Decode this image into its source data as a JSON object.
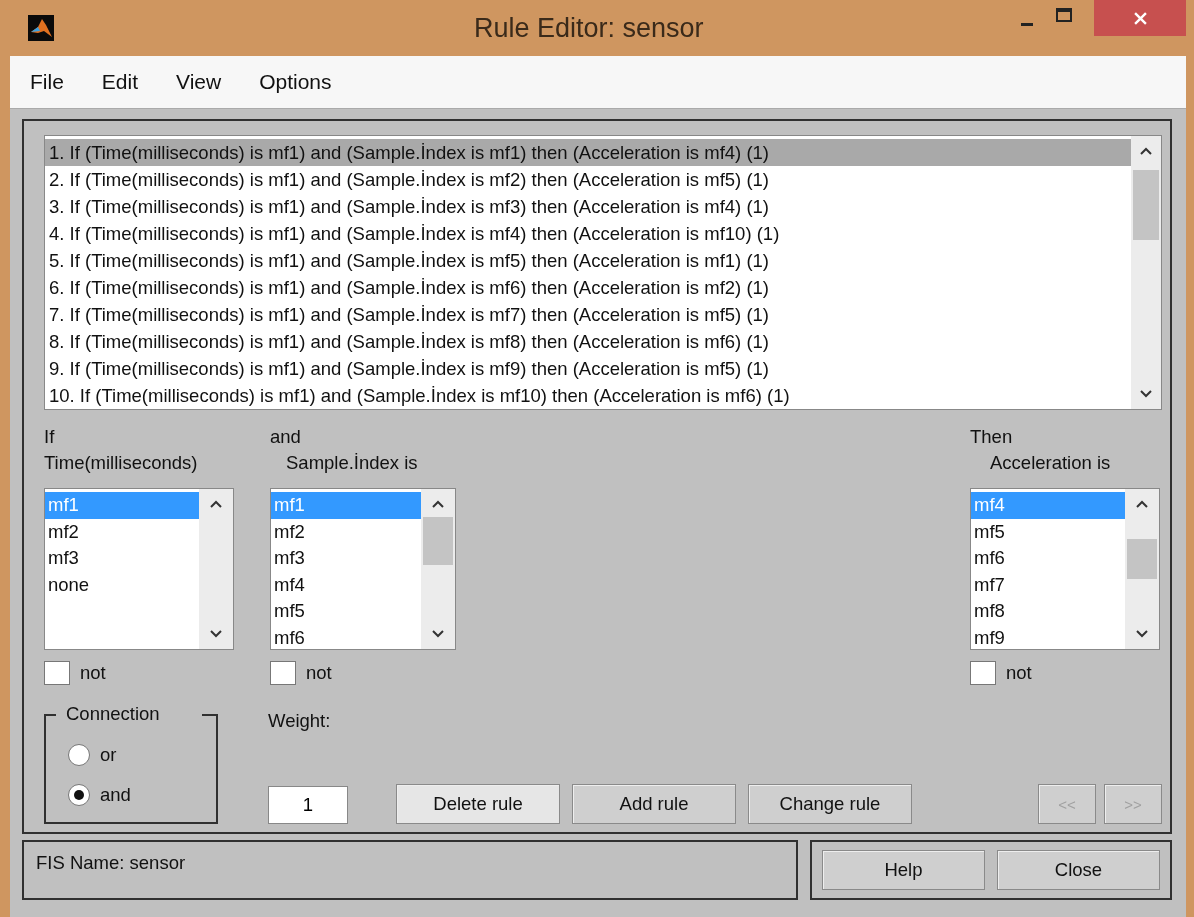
{
  "window": {
    "title": "Rule Editor: sensor"
  },
  "menu": [
    "File",
    "Edit",
    "View",
    "Options"
  ],
  "rules": [
    {
      "text": "1. If (Time(milliseconds) is mf1) and (Sample.İndex is mf1) then (Acceleration is mf4) (1)",
      "selected": true
    },
    {
      "text": "2. If (Time(milliseconds) is mf1) and (Sample.İndex is mf2) then (Acceleration is mf5) (1)",
      "selected": false
    },
    {
      "text": "3. If (Time(milliseconds) is mf1) and (Sample.İndex is mf3) then (Acceleration is mf4) (1)",
      "selected": false
    },
    {
      "text": "4. If (Time(milliseconds) is mf1) and (Sample.İndex is mf4) then (Acceleration is mf10) (1)",
      "selected": false
    },
    {
      "text": "5. If (Time(milliseconds) is mf1) and (Sample.İndex is mf5) then (Acceleration is mf1) (1)",
      "selected": false
    },
    {
      "text": "6. If (Time(milliseconds) is mf1) and (Sample.İndex is mf6) then (Acceleration is mf2) (1)",
      "selected": false
    },
    {
      "text": "7. If (Time(milliseconds) is mf1) and (Sample.İndex is mf7) then (Acceleration is mf5) (1)",
      "selected": false
    },
    {
      "text": "8. If (Time(milliseconds) is mf1) and (Sample.İndex is mf8) then (Acceleration is mf6) (1)",
      "selected": false
    },
    {
      "text": "9. If (Time(milliseconds) is mf1) and (Sample.İndex is mf9) then (Acceleration is mf5) (1)",
      "selected": false
    },
    {
      "text": "10. If (Time(milliseconds) is mf1) and (Sample.İndex is mf10) then (Acceleration is mf6) (1)",
      "selected": false
    }
  ],
  "variables": [
    {
      "kind": "input",
      "heading": "If",
      "name": "Time(milliseconds)",
      "negated": false,
      "not_label": "not",
      "items": [
        {
          "label": "mf1",
          "selected": true
        },
        {
          "label": "mf2",
          "selected": false
        },
        {
          "label": "mf3",
          "selected": false
        },
        {
          "label": "none",
          "selected": false
        }
      ]
    },
    {
      "kind": "input",
      "heading": "and",
      "name": "Sample.İndex is",
      "negated": false,
      "not_label": "not",
      "items": [
        {
          "label": "mf1",
          "selected": true
        },
        {
          "label": "mf2",
          "selected": false
        },
        {
          "label": "mf3",
          "selected": false
        },
        {
          "label": "mf4",
          "selected": false
        },
        {
          "label": "mf5",
          "selected": false
        },
        {
          "label": "mf6",
          "selected": false
        }
      ]
    },
    {
      "kind": "output",
      "heading": "Then",
      "name": "Acceleration is",
      "negated": false,
      "not_label": "not",
      "items": [
        {
          "label": "mf4",
          "selected": true
        },
        {
          "label": "mf5",
          "selected": false
        },
        {
          "label": "mf6",
          "selected": false
        },
        {
          "label": "mf7",
          "selected": false
        },
        {
          "label": "mf8",
          "selected": false
        },
        {
          "label": "mf9",
          "selected": false
        }
      ]
    }
  ],
  "connection": {
    "label": "Connection",
    "options": [
      {
        "label": "or",
        "selected": false
      },
      {
        "label": "and",
        "selected": true
      }
    ]
  },
  "weight": {
    "label": "Weight:",
    "value": "1"
  },
  "rule_buttons": [
    {
      "label": "Delete rule",
      "disabled": false
    },
    {
      "label": "Add rule",
      "disabled": false
    },
    {
      "label": "Change rule",
      "disabled": false
    }
  ],
  "nav_buttons": [
    {
      "label": "<<",
      "disabled": true
    },
    {
      "label": ">>",
      "disabled": true
    }
  ],
  "status": "FIS Name: sensor",
  "dialog_buttons": [
    "Help",
    "Close"
  ]
}
